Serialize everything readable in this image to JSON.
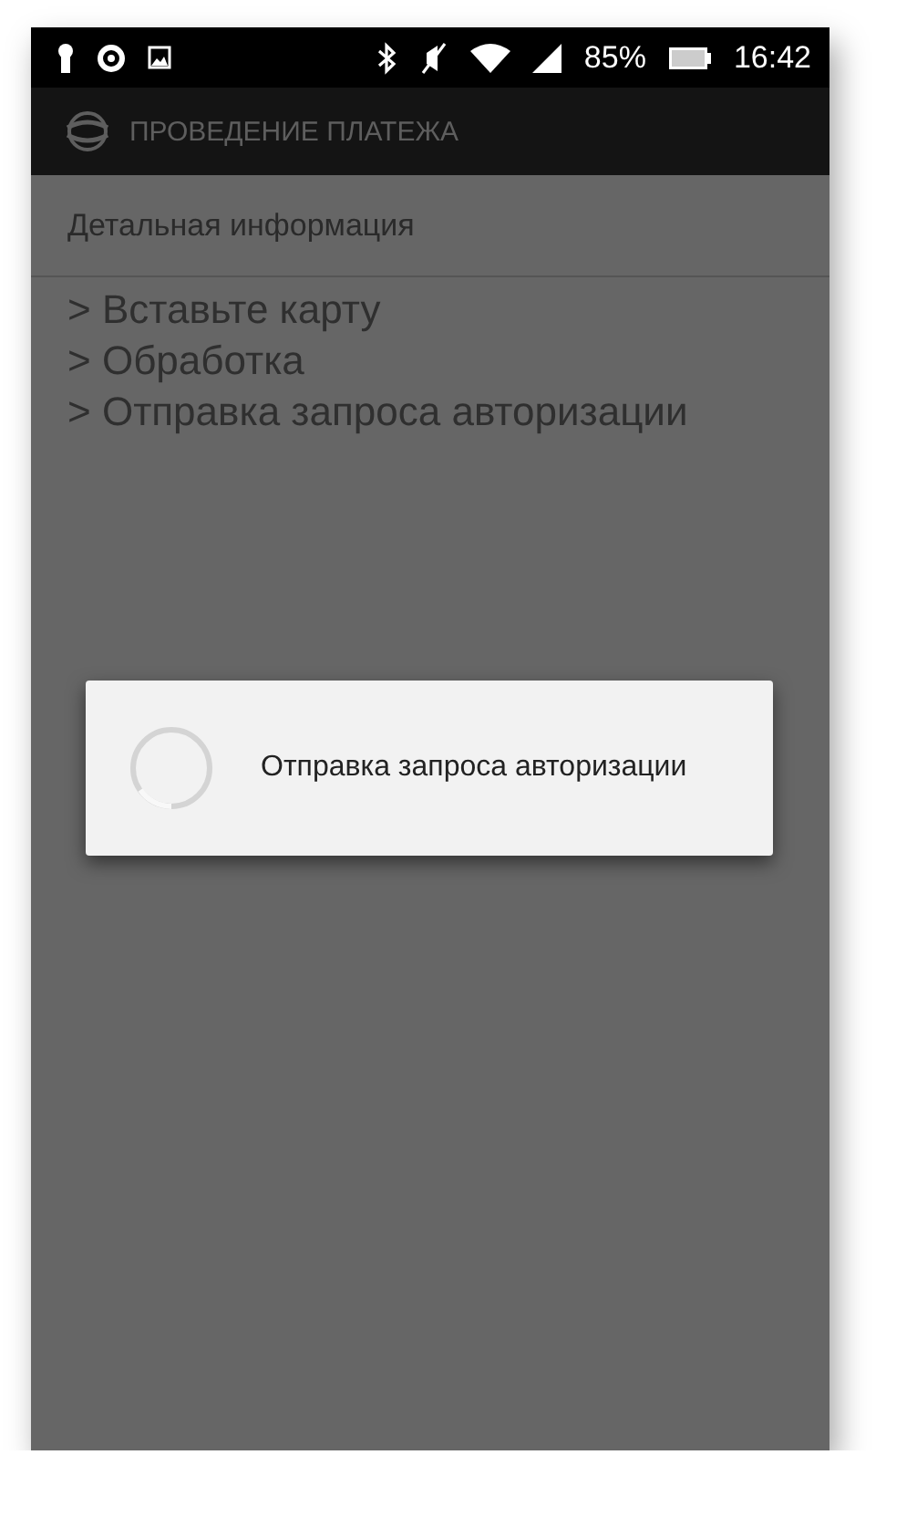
{
  "status_bar": {
    "battery": "85%",
    "time": "16:42"
  },
  "app_bar": {
    "title": "ПРОВЕДЕНИЕ ПЛАТЕЖА"
  },
  "section": {
    "title": "Детальная информация"
  },
  "log": [
    "> Вставьте карту",
    "> Обработка",
    "> Отправка запроса авторизации"
  ],
  "dialog": {
    "message": "Отправка запроса авторизации"
  }
}
